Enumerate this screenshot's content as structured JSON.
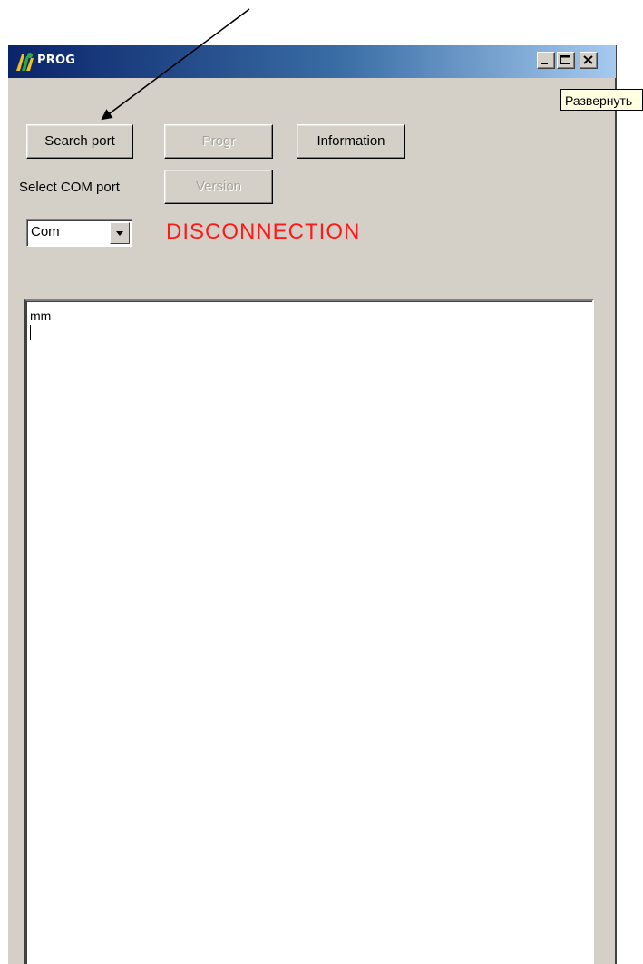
{
  "window": {
    "title": "PROG",
    "icon": "app-logo-icon",
    "controls": {
      "minimize": "minimize-icon",
      "maximize": "maximize-icon",
      "close": "close-icon"
    }
  },
  "tooltip": {
    "text": "Развернуть"
  },
  "buttons": {
    "search_port": "Search port",
    "progr": "Progr",
    "information": "Information",
    "version": "Version"
  },
  "labels": {
    "select_com_port": "Select COM port"
  },
  "com_select": {
    "value": "Com"
  },
  "status": {
    "text": "DISCONNECTION",
    "color": "#ff1a1a"
  },
  "memo": {
    "text": "mm"
  },
  "colors": {
    "window_bg": "#d4d0c8",
    "title_gradient_start": "#0a246a",
    "title_gradient_end": "#a6caf0",
    "tooltip_bg": "#ffffe1"
  }
}
